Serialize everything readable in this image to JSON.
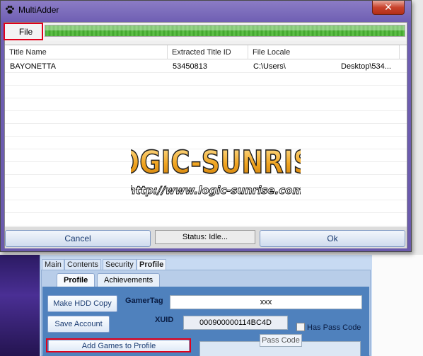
{
  "background_app": {
    "top_tabs": [
      "Main",
      "Contents",
      "Security",
      "Profile"
    ],
    "sub_tabs": [
      "Profile",
      "Achievements"
    ],
    "buttons": {
      "make_hdd_copy": "Make HDD Copy",
      "save_account": "Save Account",
      "add_games": "Add Games to Profile"
    },
    "labels": {
      "gamertag": "GamerTag",
      "xuid": "XUID",
      "has_pass_code": "Has Pass Code"
    },
    "values": {
      "gamertag": "xxx",
      "xuid": "000900000114BC4D",
      "pass_code_button": "Pass Code"
    }
  },
  "window": {
    "title": "MultiAdder",
    "close_label": "✕",
    "menu": {
      "file": "File"
    },
    "progress_percent": 100,
    "columns": [
      "Title Name",
      "Extracted Title ID",
      "File Locale"
    ],
    "rows": [
      {
        "title_name": "BAYONETTA",
        "title_id": "53450813",
        "locale_left": "C:\\Users\\",
        "locale_right": "Desktop\\534..."
      }
    ],
    "watermark": {
      "brand": "LOGIC-SUNRISE",
      "url": "http://www.logic-sunrise.com"
    },
    "bottom": {
      "cancel": "Cancel",
      "status": "Status: Idle...",
      "ok": "Ok"
    }
  },
  "colors": {
    "title_gradient": "#7b6cbd",
    "progress": "#4caf34",
    "highlight": "#e1001a",
    "profile_panel": "#4f81bd"
  }
}
